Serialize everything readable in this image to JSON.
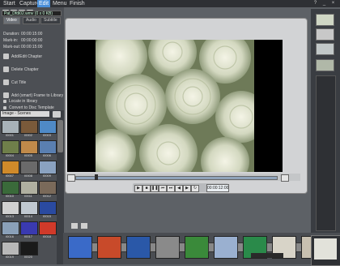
{
  "menu": {
    "items": [
      {
        "label": "Start"
      },
      {
        "label": "Capture"
      },
      {
        "label": "Edit"
      },
      {
        "label": "Menu"
      },
      {
        "label": "Finish"
      }
    ],
    "active": "Edit"
  },
  "clip_info": {
    "filename": "Pat_Dfdi02.wmv (0 x 0 KB)",
    "tabs": [
      "Video",
      "Audio",
      "Subtitle"
    ],
    "properties": [
      {
        "label": "Duration:",
        "value": "00:00:15:00"
      },
      {
        "label": "Mark-in:",
        "value": "00:00:00:00"
      },
      {
        "label": "Mark-out:",
        "value": "00:00:15:00"
      }
    ],
    "actions": [
      {
        "label": "Add/Edit Chapter"
      },
      {
        "label": "Delete Chapter"
      },
      {
        "label": "Cut Title"
      },
      {
        "label": "Add (smart) Frame to Library"
      },
      {
        "label": "Locate in library"
      },
      {
        "label": "Convert to Disc Template"
      }
    ]
  },
  "library": {
    "category": "Image - Scenes",
    "thumbs": [
      {
        "label": "I0001",
        "color": "#a8b2b8"
      },
      {
        "label": "I0002",
        "color": "#7a5a3a"
      },
      {
        "label": "I0003",
        "color": "#4f8ac6"
      },
      {
        "label": "I0004",
        "color": "#6f7f4a"
      },
      {
        "label": "I0005",
        "color": "#c08a4a"
      },
      {
        "label": "I0006",
        "color": "#5a7fb0"
      },
      {
        "label": "I0007",
        "color": "#d08a2a"
      },
      {
        "label": "I0008",
        "color": "#6a6a6a"
      },
      {
        "label": "I0009",
        "color": "#8aa2c0"
      },
      {
        "label": "I0010",
        "color": "#3a6a3a"
      },
      {
        "label": "I0011",
        "color": "#b0b0a0"
      },
      {
        "label": "I0012",
        "color": "#7a6a5a"
      },
      {
        "label": "I0013",
        "color": "#d0d0d0"
      },
      {
        "label": "I0014",
        "color": "#c0c8d0"
      },
      {
        "label": "I0015",
        "color": "#2a4aa0"
      },
      {
        "label": "I0016",
        "color": "#8aa0b8"
      },
      {
        "label": "I0017",
        "color": "#3a3ab0"
      },
      {
        "label": "I0018",
        "color": "#d03a2a"
      },
      {
        "label": "I0019",
        "color": "#b8b8b8"
      },
      {
        "label": "I0020",
        "color": "#1a1a1a"
      }
    ]
  },
  "player": {
    "timecode": "00:00:12:00",
    "controls": [
      "play-icon",
      "stop-icon",
      "pause-icon",
      "prev-icon",
      "next-icon",
      "rewind-icon",
      "forward-icon",
      "loop-icon"
    ]
  },
  "timeline": {
    "clips": [
      {
        "color": "#3a6ac8"
      },
      {
        "color": "#c84a2a"
      },
      {
        "color": "#2a58a8"
      },
      {
        "color": "#8a8a8a"
      },
      {
        "color": "#3a8a3a"
      },
      {
        "color": "#9ab0d0"
      },
      {
        "color": "#2a8a4a"
      },
      {
        "color": "#d8d4c8"
      },
      {
        "color": "#c8c0b0"
      }
    ]
  }
}
